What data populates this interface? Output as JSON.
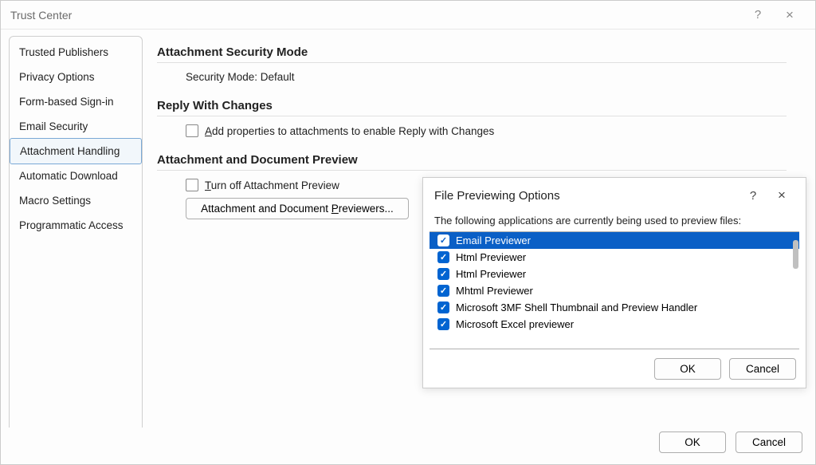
{
  "window": {
    "title": "Trust Center",
    "help_label": "?",
    "close_label": "×"
  },
  "sidebar": {
    "items": [
      {
        "label": "Trusted Publishers"
      },
      {
        "label": "Privacy Options"
      },
      {
        "label": "Form-based Sign-in"
      },
      {
        "label": "Email Security"
      },
      {
        "label": "Attachment Handling",
        "selected": true
      },
      {
        "label": "Automatic Download"
      },
      {
        "label": "Macro Settings"
      },
      {
        "label": "Programmatic Access"
      }
    ]
  },
  "sections": {
    "attachment_security": {
      "heading": "Attachment Security Mode",
      "security_mode_text": "Security Mode: Default"
    },
    "reply_with_changes": {
      "heading": "Reply With Changes",
      "checkbox_label_prefix": "A",
      "checkbox_label_rest": "dd properties to attachments to enable Reply with Changes",
      "checked": false
    },
    "attachment_preview": {
      "heading": "Attachment and Document Preview",
      "checkbox_label_prefix": "T",
      "checkbox_label_rest": "urn off Attachment Preview",
      "checked": false,
      "previewers_button_prefix": "Attachment and Document ",
      "previewers_button_u": "P",
      "previewers_button_rest": "reviewers..."
    }
  },
  "footer": {
    "ok_label": "OK",
    "cancel_label": "Cancel"
  },
  "inner_dialog": {
    "title": "File Previewing Options",
    "help_label": "?",
    "close_label": "×",
    "instruction": "The following applications are currently being used to preview files:",
    "items": [
      {
        "label": "Email Previewer",
        "checked": true,
        "selected": true
      },
      {
        "label": "Html Previewer",
        "checked": true
      },
      {
        "label": "Html Previewer",
        "checked": true
      },
      {
        "label": "Mhtml Previewer",
        "checked": true
      },
      {
        "label": "Microsoft 3MF Shell Thumbnail and Preview Handler",
        "checked": true
      },
      {
        "label": "Microsoft Excel previewer",
        "checked": true
      }
    ],
    "ok_label": "OK",
    "cancel_label": "Cancel"
  }
}
